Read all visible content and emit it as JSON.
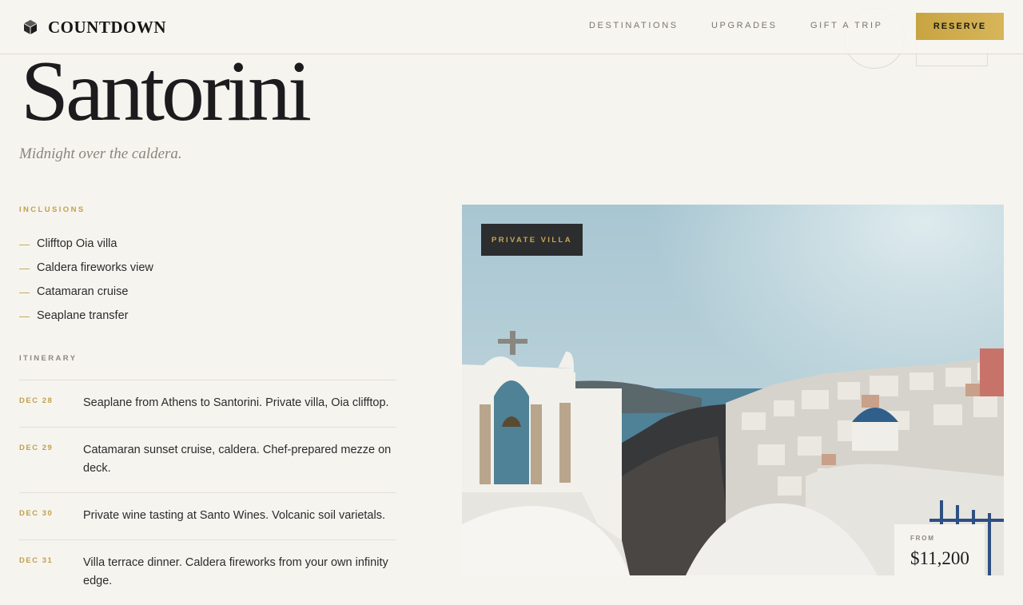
{
  "header": {
    "brand": "COUNTDOWN",
    "nav": [
      "DESTINATIONS",
      "UPGRADES",
      "GIFT A TRIP"
    ],
    "cta": "RESERVE"
  },
  "hero": {
    "title": "Santorini",
    "subtitle": "Midnight over the caldera."
  },
  "inclusions": {
    "label": "INCLUSIONS",
    "items": [
      "Clifftop Oia villa",
      "Caldera fireworks view",
      "Catamaran cruise",
      "Seaplane transfer"
    ]
  },
  "itinerary": {
    "label": "ITINERARY",
    "days": [
      {
        "date": "DEC 28",
        "text": "Seaplane from Athens to Santorini. Private villa, Oia clifftop."
      },
      {
        "date": "DEC 29",
        "text": "Catamaran sunset cruise, caldera. Chef-prepared mezze on deck."
      },
      {
        "date": "DEC 30",
        "text": "Private wine tasting at Santo Wines. Volcanic soil varietals."
      },
      {
        "date": "DEC 31",
        "text": "Villa terrace dinner. Caldera fireworks from your own infinity edge."
      }
    ]
  },
  "photo": {
    "badge": "PRIVATE VILLA",
    "price_label": "FROM",
    "price": "$11,200"
  },
  "colors": {
    "accent_gold": "#c8a441",
    "background": "#f6f4ef",
    "badge_dark": "#2c2d2f"
  },
  "icons": {
    "brand": "logo-gem-icon",
    "list_marker": "dash-icon"
  }
}
